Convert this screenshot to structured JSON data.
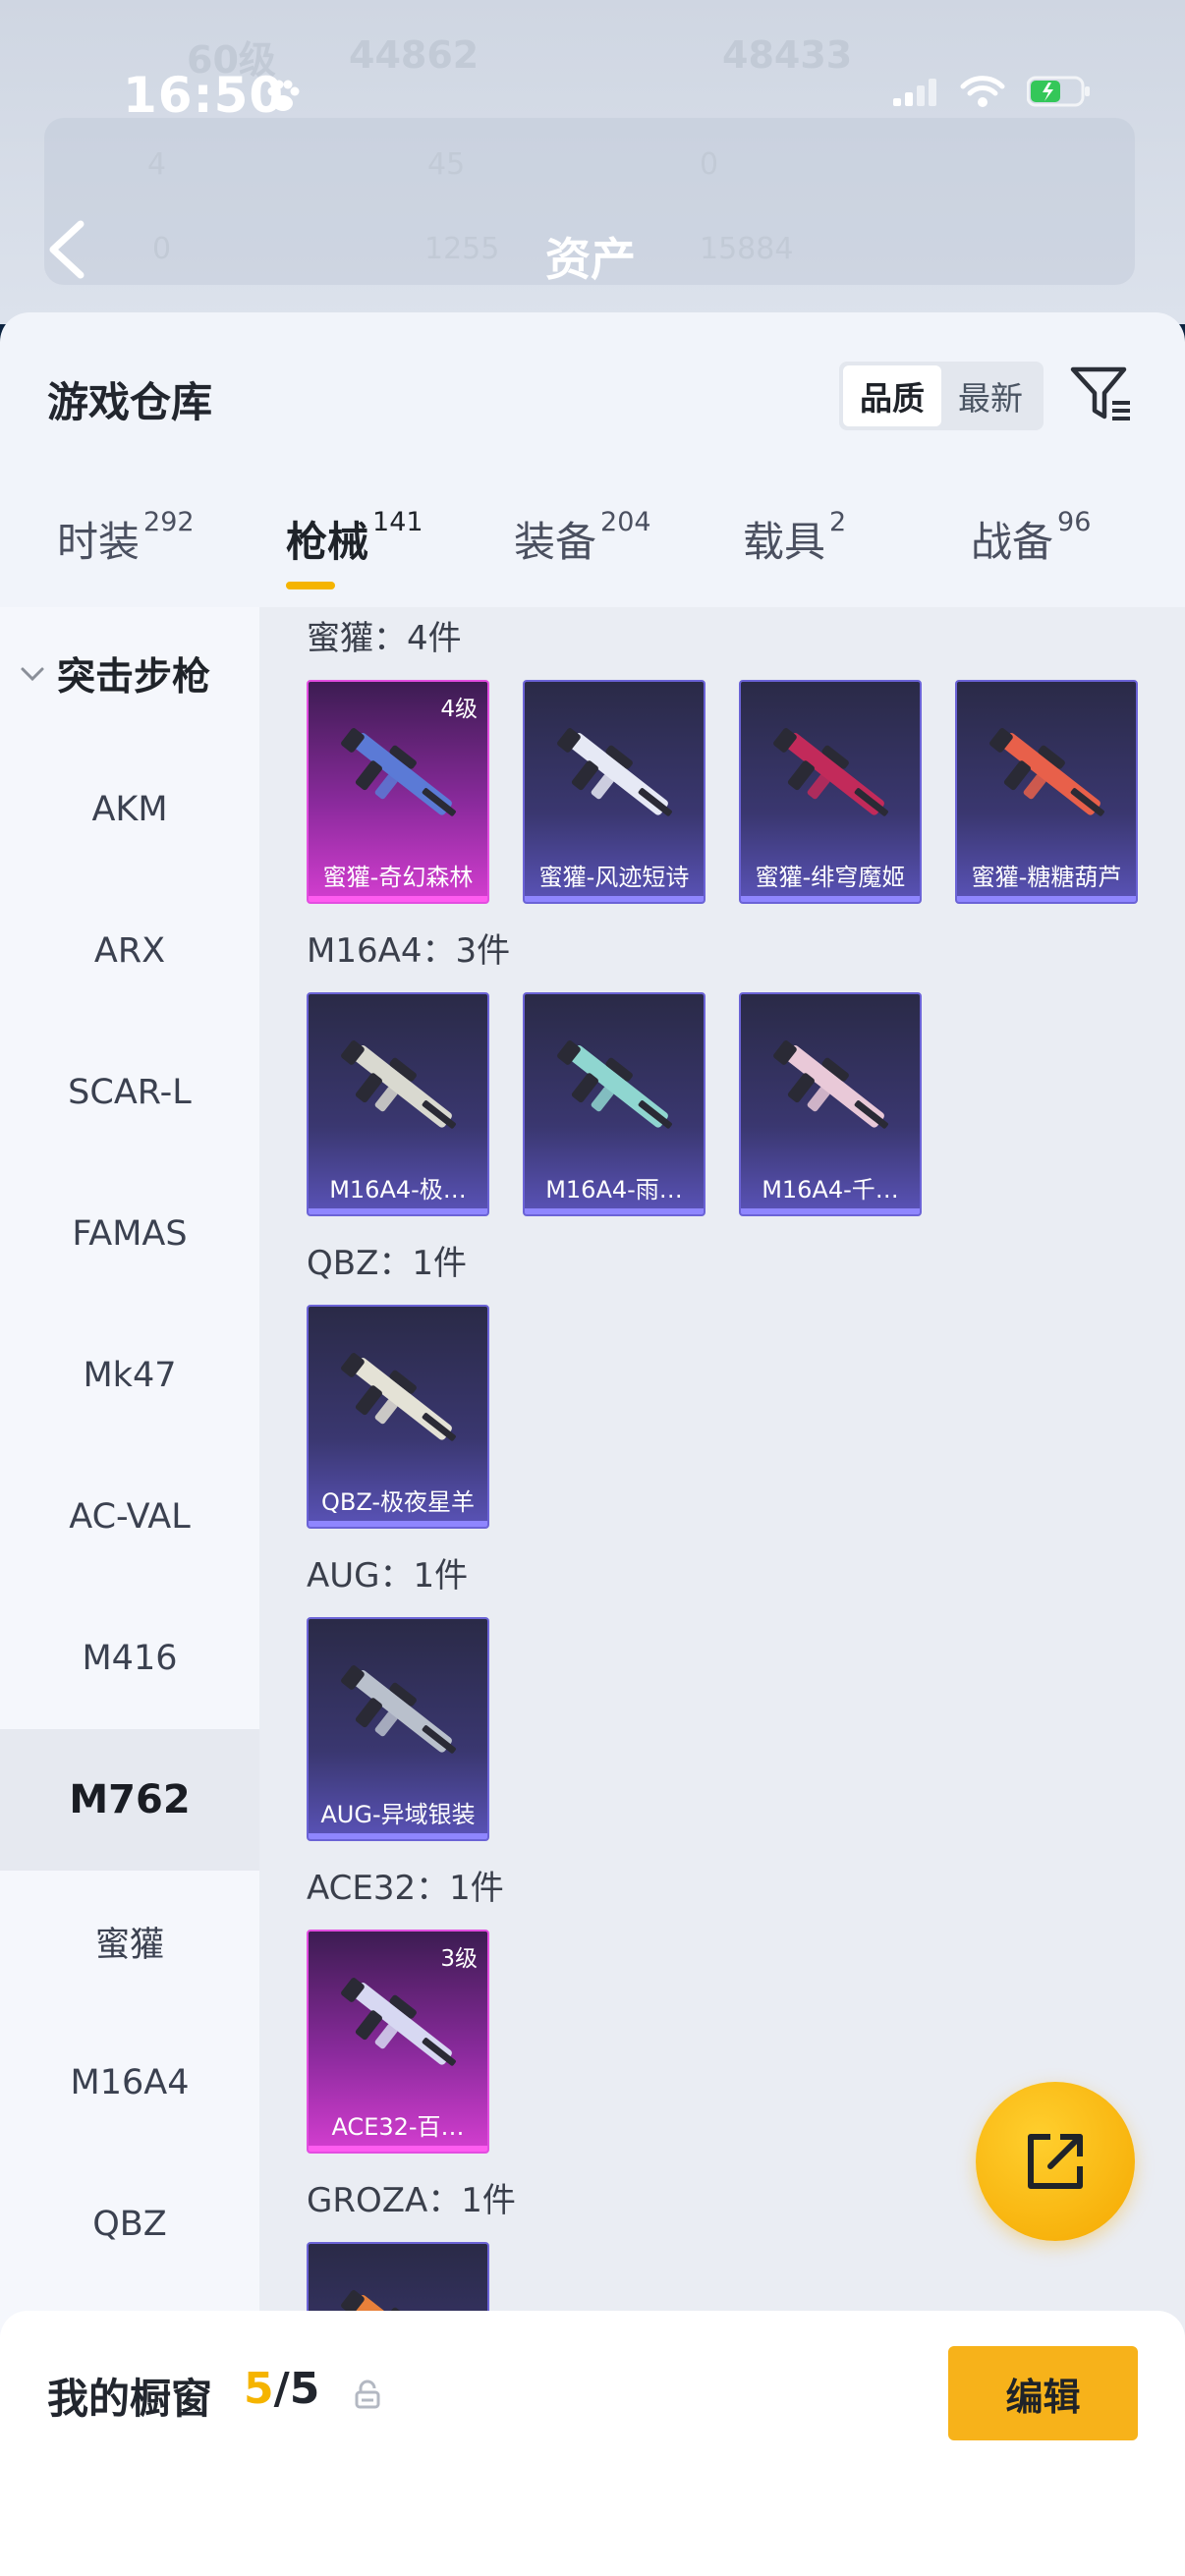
{
  "status_bar": {
    "time": "16:50"
  },
  "header": {
    "title": "资产",
    "ghost_texts": {
      "level": "60级",
      "stat_a": "44862",
      "stat_b": "48433",
      "row1_a": "4",
      "row1_b": "45",
      "row1_c": "0",
      "row2_a": "0",
      "row2_b": "1255",
      "row2_c": "15884"
    }
  },
  "warehouse": {
    "title": "游戏仓库",
    "sort_options": [
      "品质",
      "最新"
    ],
    "sort_selected": "品质"
  },
  "tabs": [
    {
      "label": "时装",
      "count": "292"
    },
    {
      "label": "枪械",
      "count": "141",
      "active": true
    },
    {
      "label": "装备",
      "count": "204"
    },
    {
      "label": "载具",
      "count": "2"
    },
    {
      "label": "战备",
      "count": "96"
    }
  ],
  "sidebar": {
    "category": "突击步枪",
    "items": [
      "AKM",
      "ARX",
      "SCAR-L",
      "FAMAS",
      "Mk47",
      "AC-VAL",
      "M416",
      "M762",
      "蜜獾",
      "M16A4",
      "QBZ"
    ],
    "active": "M762"
  },
  "groups": [
    {
      "title": "蜜獾：4件",
      "items": [
        {
          "name": "蜜獾-奇幻森林",
          "level": "4级",
          "rarity": "pink",
          "accent": "#5b7ad6"
        },
        {
          "name": "蜜獾-风迹短诗",
          "level": "",
          "rarity": "purple",
          "accent": "#e6e9f5"
        },
        {
          "name": "蜜獾-绯穹魔姬",
          "level": "",
          "rarity": "purple",
          "accent": "#c22a5a"
        },
        {
          "name": "蜜獾-糖糖葫芦",
          "level": "",
          "rarity": "purple",
          "accent": "#e8604a"
        }
      ]
    },
    {
      "title": "M16A4：3件",
      "items": [
        {
          "name": "M16A4-极…",
          "level": "",
          "rarity": "purple",
          "accent": "#d9d9d0"
        },
        {
          "name": "M16A4-雨…",
          "level": "",
          "rarity": "purple",
          "accent": "#8fd6d0"
        },
        {
          "name": "M16A4-千…",
          "level": "",
          "rarity": "purple",
          "accent": "#e9c9d8"
        }
      ]
    },
    {
      "title": "QBZ：1件",
      "items": [
        {
          "name": "QBZ-极夜星羊",
          "level": "",
          "rarity": "purple",
          "accent": "#e4e2d6"
        }
      ]
    },
    {
      "title": "AUG：1件",
      "items": [
        {
          "name": "AUG-异域银装",
          "level": "",
          "rarity": "purple",
          "accent": "#b9c0cc"
        }
      ]
    },
    {
      "title": "ACE32：1件",
      "items": [
        {
          "name": "ACE32-百…",
          "level": "3级",
          "rarity": "pink",
          "accent": "#d7d8f2"
        }
      ]
    },
    {
      "title": "GROZA：1件",
      "items": [
        {
          "name": "",
          "level": "",
          "rarity": "purple",
          "accent": "#e8803a"
        }
      ]
    }
  ],
  "showcase": {
    "label": "我的橱窗",
    "current": "5",
    "total": "/5",
    "edit_label": "编辑"
  },
  "colors": {
    "accent": "#f5b400",
    "purple_card": "#3a3770",
    "pink_card": "#d43ed0"
  }
}
